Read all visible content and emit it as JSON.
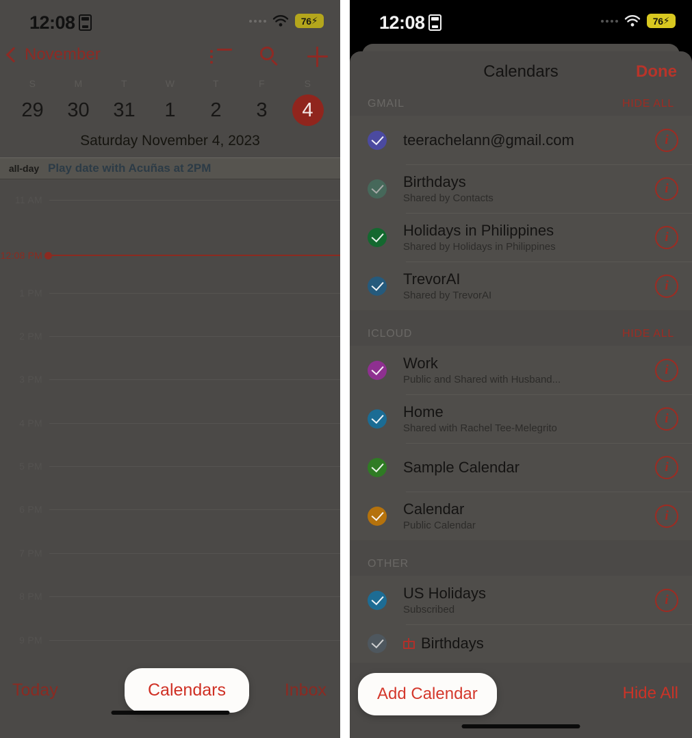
{
  "status_bar": {
    "time": "12:08",
    "lock_icon": "lock-portrait-orientation-icon",
    "wifi_icon": "wifi-icon",
    "battery_level": "76",
    "battery_charging": true
  },
  "left_panel": {
    "nav": {
      "back_label": "November",
      "back_icon": "chevron-left-icon",
      "list_icon": "list-view-icon",
      "search_icon": "search-icon",
      "add_icon": "plus-icon"
    },
    "week": {
      "weekdays": [
        "S",
        "M",
        "T",
        "W",
        "T",
        "F",
        "S"
      ],
      "days": [
        {
          "num": "29",
          "state": "dim"
        },
        {
          "num": "30",
          "state": "normal"
        },
        {
          "num": "31",
          "state": "normal"
        },
        {
          "num": "1",
          "state": "normal"
        },
        {
          "num": "2",
          "state": "normal"
        },
        {
          "num": "3",
          "state": "normal"
        },
        {
          "num": "4",
          "state": "selected"
        }
      ]
    },
    "day_title": "Saturday  November 4, 2023",
    "all_day": {
      "label": "all-day",
      "event": "Play date with Acuñas at 2PM"
    },
    "timeline": {
      "hours": [
        "11 AM",
        "1 PM",
        "2 PM",
        "3 PM",
        "4 PM",
        "5 PM",
        "6 PM",
        "7 PM",
        "8 PM",
        "9 PM"
      ],
      "now_label": "12:08 PM"
    },
    "tabbar": {
      "today": "Today",
      "calendars": "Calendars",
      "inbox": "Inbox"
    }
  },
  "right_panel": {
    "header": {
      "title": "Calendars",
      "done": "Done"
    },
    "sections": [
      {
        "title": "GMAIL",
        "action": "HIDE ALL",
        "rows": [
          {
            "title": "teerachelann@gmail.com",
            "subtitle": "",
            "color": "#4b4aa0",
            "checked": true,
            "dim": false,
            "gift": false,
            "info_icon": "info-circle-icon"
          },
          {
            "title": "Birthdays",
            "subtitle": "Shared by Contacts",
            "color": "#3f7f68",
            "checked": true,
            "dim": true,
            "gift": false,
            "info_icon": "info-circle-icon"
          },
          {
            "title": "Holidays in Philippines",
            "subtitle": "Shared by Holidays in Philippines",
            "color": "#14682f",
            "checked": true,
            "dim": false,
            "gift": false,
            "info_icon": "info-circle-icon"
          },
          {
            "title": "TrevorAI",
            "subtitle": "Shared by TrevorAI",
            "color": "#255a7c",
            "checked": true,
            "dim": false,
            "gift": false,
            "info_icon": "info-circle-icon"
          }
        ]
      },
      {
        "title": "ICLOUD",
        "action": "HIDE ALL",
        "rows": [
          {
            "title": "Work",
            "subtitle": "Public and Shared with Husband...",
            "color": "#8e3090",
            "checked": true,
            "dim": false,
            "gift": false,
            "info_icon": "info-circle-icon"
          },
          {
            "title": "Home",
            "subtitle": "Shared with Rachel Tee-Melegrito",
            "color": "#1b6c94",
            "checked": true,
            "dim": false,
            "gift": false,
            "info_icon": "info-circle-icon"
          },
          {
            "title": "Sample Calendar",
            "subtitle": "",
            "color": "#2f7b24",
            "checked": true,
            "dim": false,
            "gift": false,
            "info_icon": "info-circle-icon"
          },
          {
            "title": "Calendar",
            "subtitle": "Public Calendar",
            "color": "#b5720c",
            "checked": true,
            "dim": false,
            "gift": false,
            "info_icon": "info-circle-icon"
          }
        ]
      },
      {
        "title": "OTHER",
        "action": "",
        "rows": [
          {
            "title": "US Holidays",
            "subtitle": "Subscribed",
            "color": "#1d6c94",
            "checked": true,
            "dim": false,
            "gift": false,
            "info_icon": "info-circle-icon"
          },
          {
            "title": "Birthdays",
            "subtitle": "",
            "color": "#4e5a63",
            "checked": true,
            "dim": true,
            "gift": true,
            "info_icon": ""
          }
        ]
      }
    ],
    "bottom": {
      "add_calendar": "Add Calendar",
      "hide_all": "Hide All"
    }
  },
  "colors": {
    "accent_red": "#cf2f23",
    "dim_overlay": "#4b4947",
    "selected_day": "#90251d"
  }
}
